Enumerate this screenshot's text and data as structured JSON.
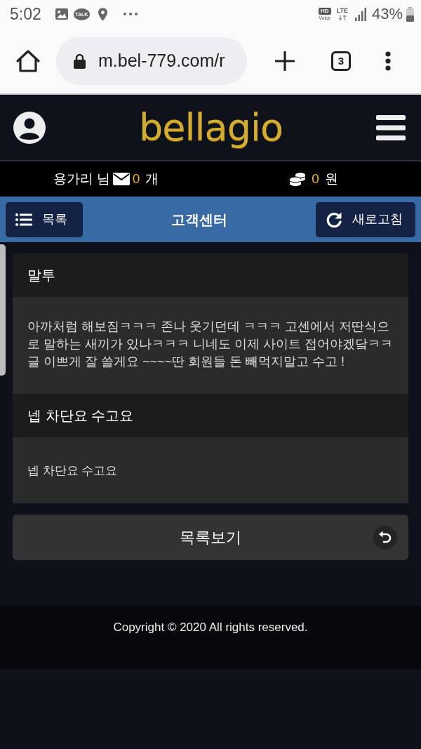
{
  "status_bar": {
    "time": "5:02",
    "talk_badge": "TALK",
    "hd_badge": "HD",
    "voice_label": "Voice",
    "network": "LTE",
    "battery": "43%"
  },
  "browser": {
    "url": "m.bel-779.com/r",
    "tab_count": "3"
  },
  "header": {
    "logo": "bellagio"
  },
  "user_bar": {
    "user": "용가리 님",
    "messages": "0",
    "messages_unit": "개",
    "money": "0",
    "money_unit": "원"
  },
  "title_bar": {
    "list_button": "목록",
    "title": "고객센터",
    "refresh_button": "새로고침"
  },
  "post": {
    "title": "말투",
    "body": "아까처럼 해보짐ㅋㅋㅋ 존나 웃기던데 ㅋㅋㅋ 고센에서 저딴식으로 말하는 새끼가 있나ㅋㅋㅋ 니네도 이제 사이트 접어야겠닼ㅋㅋ 글 이쁘게 잘 쓸게요 ~~~~딴 회원들 돈 빼먹지말고 수고 !",
    "reply_title": "넵 차단요 수고요",
    "reply_body": "넵 차단요 수고요"
  },
  "list_view_button": "목록보기",
  "footer": {
    "copyright": "Copyright © 2020 All rights reserved."
  }
}
